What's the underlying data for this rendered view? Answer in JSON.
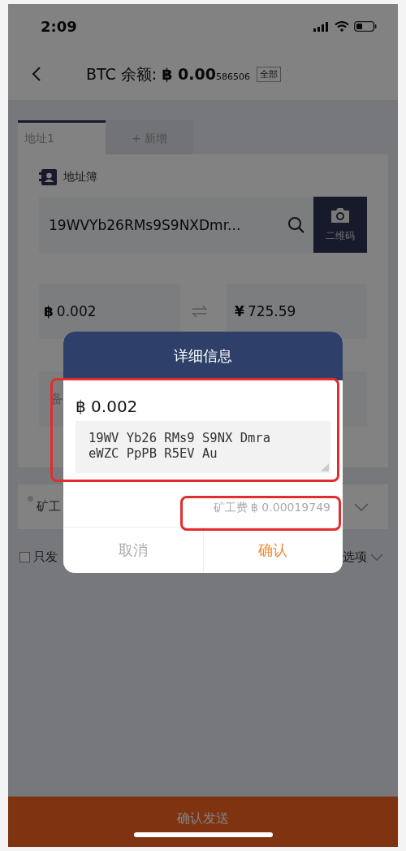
{
  "status_bar": {
    "time": "2:09"
  },
  "header": {
    "title": "BTC 余额:",
    "currency_symbol": "฿",
    "balance_main": "0.00",
    "balance_minor": "586506",
    "all_badge": "全部"
  },
  "tabs": [
    {
      "label": "地址1",
      "selected": true
    },
    {
      "label": "+ 新增",
      "selected": false
    }
  ],
  "address_book_link": "地址簿",
  "address_field": {
    "value": "19WVYb26RMs9S9NXDmr..."
  },
  "qr_button": "二维码",
  "amount_btc": {
    "symbol": "฿",
    "value": "0.002"
  },
  "amount_cny": {
    "symbol": "¥",
    "value": "725.59"
  },
  "note_field": {
    "placeholder": "备"
  },
  "fee_row": {
    "label": "矿工"
  },
  "only_send_checkbox": {
    "label": "只发",
    "checked": false
  },
  "options_toggle": "选项",
  "send_button": "确认发送",
  "dialog": {
    "title": "详细信息",
    "amount": "฿ 0.002",
    "address": "19WV Yb26 RMs9 S9NX Dmra eWZC PpPB R5EV Au",
    "fee": "矿工费 ฿ 0.00019749",
    "cancel": "取消",
    "confirm": "确认"
  }
}
